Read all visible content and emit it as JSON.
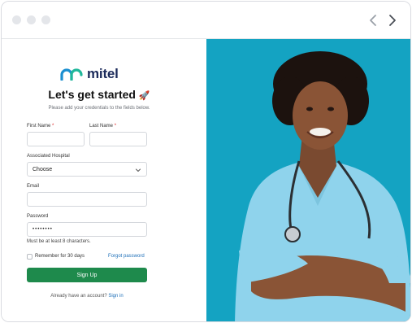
{
  "brand": {
    "name": "mitel",
    "logo_color": "#1b8fd0"
  },
  "header": {
    "title": "Let's get started",
    "title_emoji": "🚀",
    "subtitle": "Please add your credentials to the fields below."
  },
  "form": {
    "first_name": {
      "label": "First Name",
      "required_mark": "*",
      "value": ""
    },
    "last_name": {
      "label": "Last Name",
      "required_mark": "*",
      "value": ""
    },
    "hospital": {
      "label": "Associated Hospital",
      "selected": "Choose"
    },
    "email": {
      "label": "Email",
      "value": ""
    },
    "password": {
      "label": "Password",
      "value": "••••••••",
      "hint": "Must be at least 8 characters."
    },
    "remember_label": "Remember for 30 days",
    "forgot_label": "Forgot password",
    "submit_label": "Sign Up"
  },
  "footer": {
    "prompt": "Already have an account?",
    "link_label": "Sign in"
  },
  "colors": {
    "primary_button": "#1e8a4c",
    "link": "#1d6fb8",
    "photo_background": "#14a3c2"
  }
}
